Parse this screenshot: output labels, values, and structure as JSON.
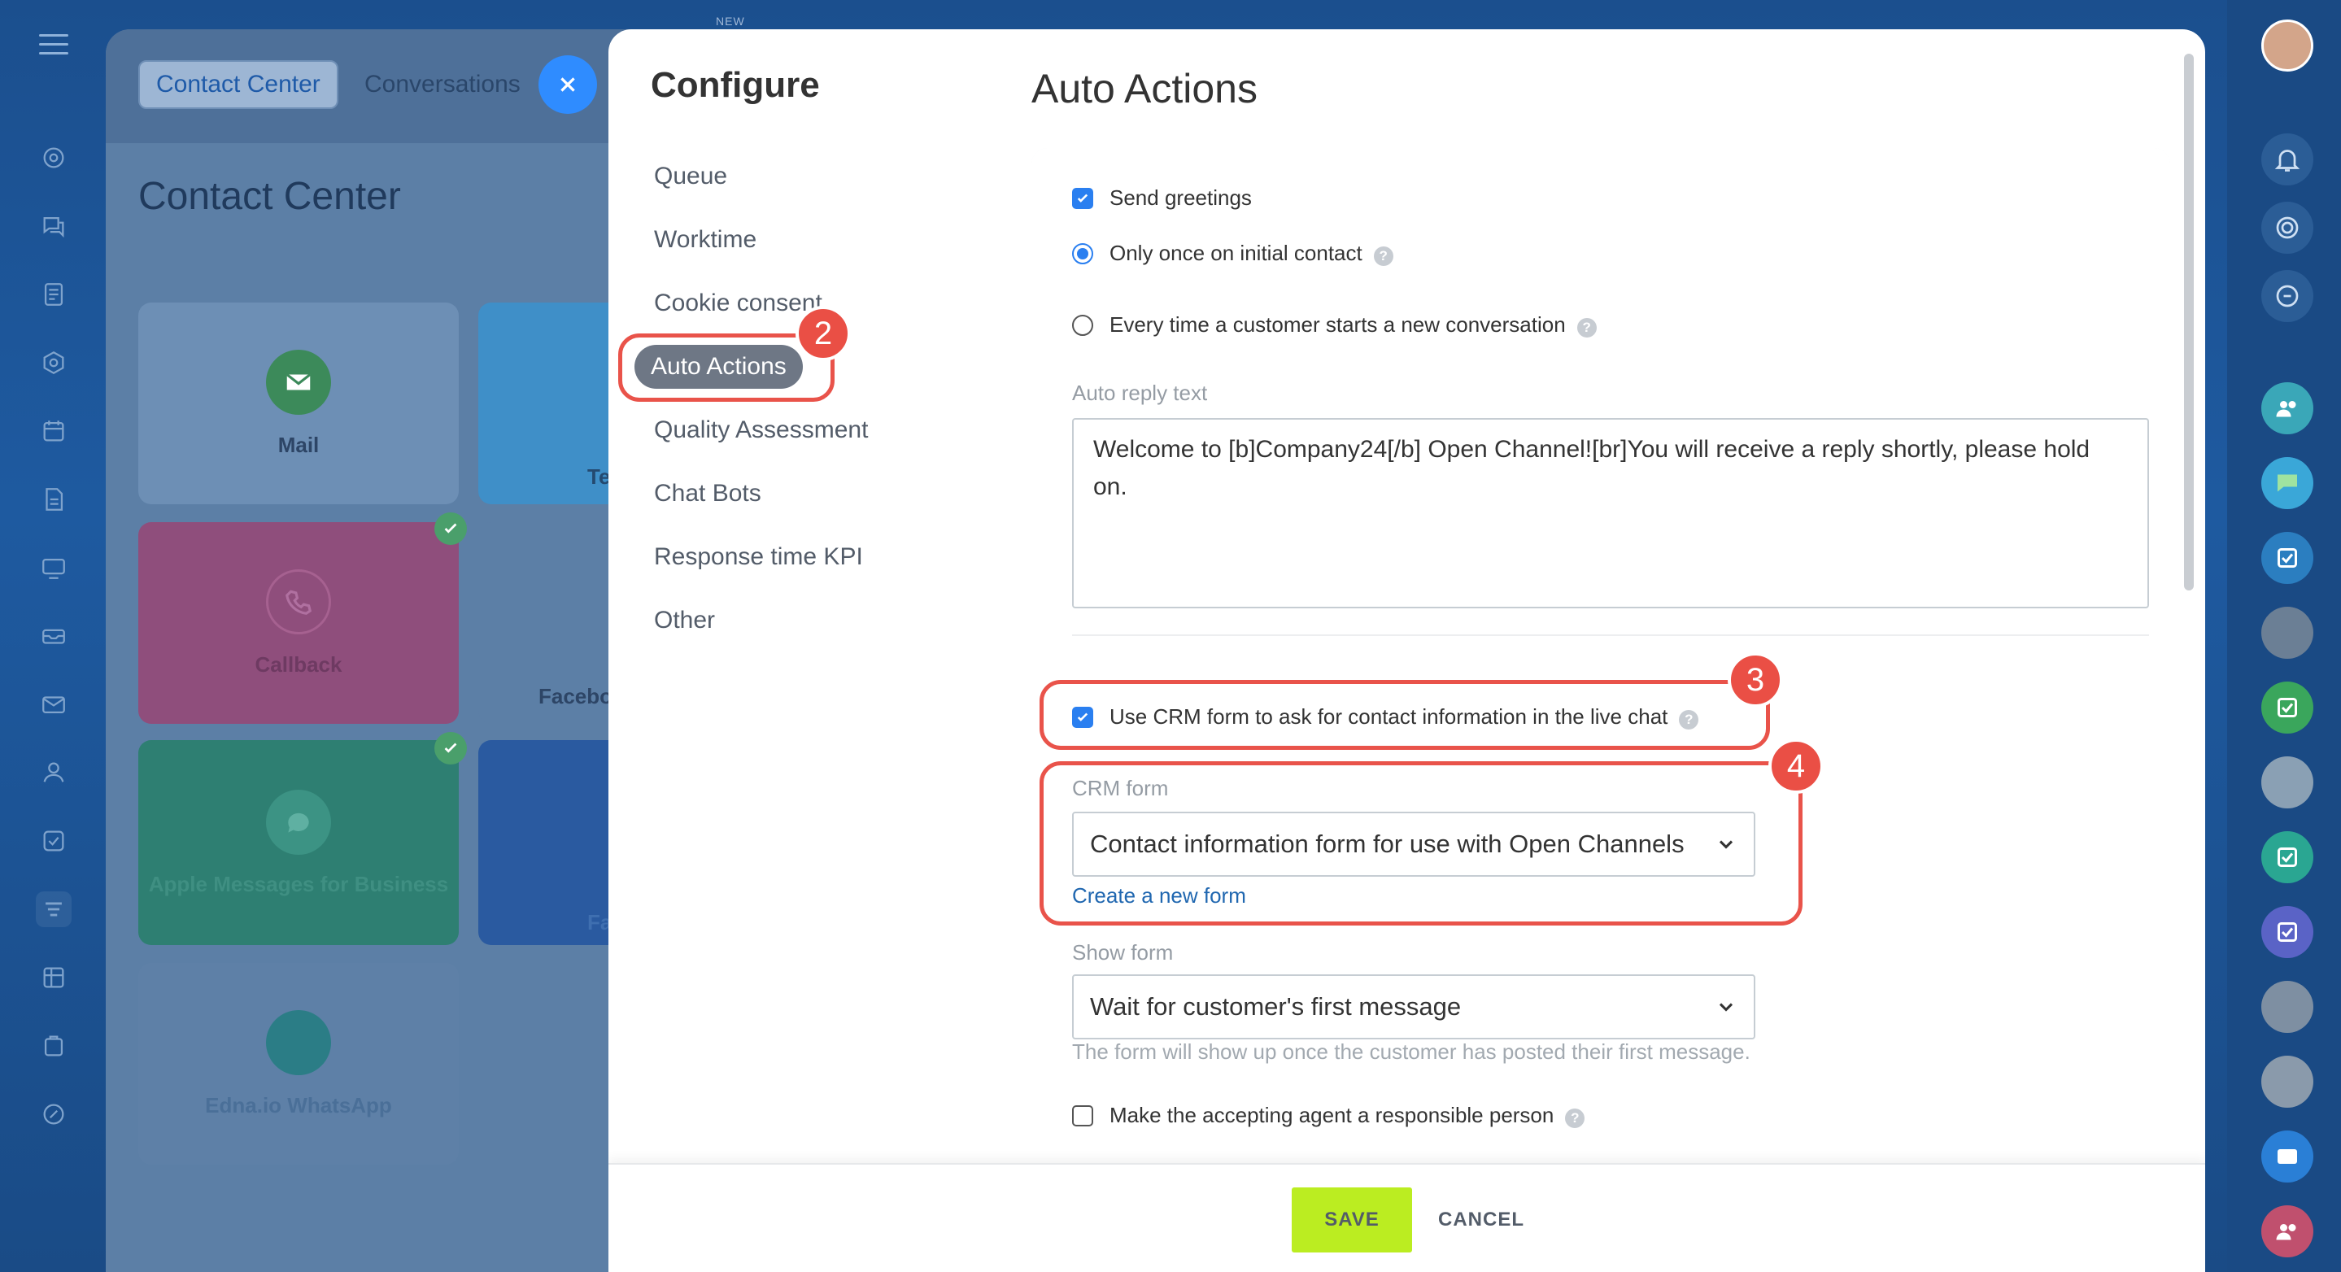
{
  "background_app": {
    "new_label": "NEW",
    "tabs": [
      "Contact Center",
      "Conversations"
    ],
    "title": "Contact Center",
    "cards": {
      "mail": "Mail",
      "te": "Te",
      "callback": "Callback",
      "facebo": "Facebo",
      "apple": "Apple Messages for Business",
      "fa": "Fa",
      "edna": "Edna.io WhatsApp"
    }
  },
  "dialog": {
    "configure_title": "Configure",
    "menu": [
      "Queue",
      "Worktime",
      "Cookie consent",
      "Auto Actions",
      "Quality Assessment",
      "Chat Bots",
      "Response time KPI",
      "Other"
    ],
    "active_menu": "Auto Actions",
    "content_title": "Auto Actions",
    "send_greetings": "Send greetings",
    "radio_once": "Only once on initial contact",
    "radio_every": "Every time a customer starts a new conversation",
    "auto_reply_label": "Auto reply text",
    "auto_reply_text": "Welcome to [b]Company24[/b] Open Channel![br]You will receive a reply shortly, please hold on.",
    "use_crm_form": "Use CRM form to ask for contact information in the live chat",
    "crm_form_label": "CRM form",
    "crm_form_value": "Contact information form for use with Open Channels",
    "create_form_link": "Create a new form",
    "show_form_label": "Show form",
    "show_form_value": "Wait for customer's first message",
    "show_form_hint": "The form will show up once the customer has posted their first message.",
    "responsible_person": "Make the accepting agent a responsible person",
    "help_glyph": "?",
    "save": "SAVE",
    "cancel": "CANCEL"
  },
  "annotations": [
    "2",
    "3",
    "4"
  ],
  "colors": {
    "accent": "#2a7ff0",
    "highlight": "#e9534a",
    "save_button": "#bbed21",
    "link": "#2067b0"
  }
}
